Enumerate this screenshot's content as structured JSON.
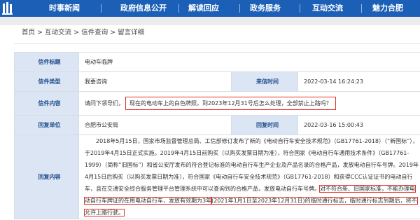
{
  "nav": {
    "items": [
      "时事新闻",
      "政府信息公开",
      "解读回应",
      "政务服务",
      "互动交流",
      "魅力合肥"
    ]
  },
  "breadcrumb": {
    "items": [
      "首页",
      "互动交流",
      "信件查询",
      "留言详细"
    ],
    "separator": ">"
  },
  "letter": {
    "title_label": "信件标题",
    "title": "电动车临牌",
    "type_label": "信件类型",
    "type": "我要咨询",
    "date_label": "来信时间",
    "date": "2022-03-14 16:24:23",
    "content_label": "信件内容",
    "content_prefix": "请问下领导们，",
    "content_highlight": "现在的电动车上的白色牌照，到2023年12月31号后怎么处理，全部禁止上路吗？",
    "unit_label": "回复单位",
    "unit": "合肥市公安局",
    "reply_date_label": "回复时间",
    "reply_date": "2022-03-16 15:00:43",
    "reply_label": "回复内容",
    "reply_text_1": "2018年5月15日，国家市场监督管理总局、工信部修订发布了新的《电动自行车安全技术规范》（GB17761-2018）（“新国标”），于2019年4月15日正式实施。2019年4月15日前购买（以购买发票日期为准），符合国家《电动自行车通用技术条件》（GB17761-1999）（简称“旧国标”）和省公安厅发布的符合登记标准的电动自行车生产企业及产品名录的合格产品，发放电动自行车号牌。2019年4月15日后购买（以购买发票日期为准），符合国家《电动自行车安全技术规范》（GB17761-2018）和获得CCC认证证书的电动自行车，且在交通安全综合服务管理平台管理系统中可以查询到的合格产品，发放电动自行车号牌。",
    "reply_text_2": "对不符合新、旧国家标准，不能办理电动自行车牌证的在用电动自行车，发放有效期为3年",
    "reply_text_3": "(2021年1月1日至2023年12月31日)的临时通行标志，临时通行标志到期后，将不允许上路行驶。"
  }
}
